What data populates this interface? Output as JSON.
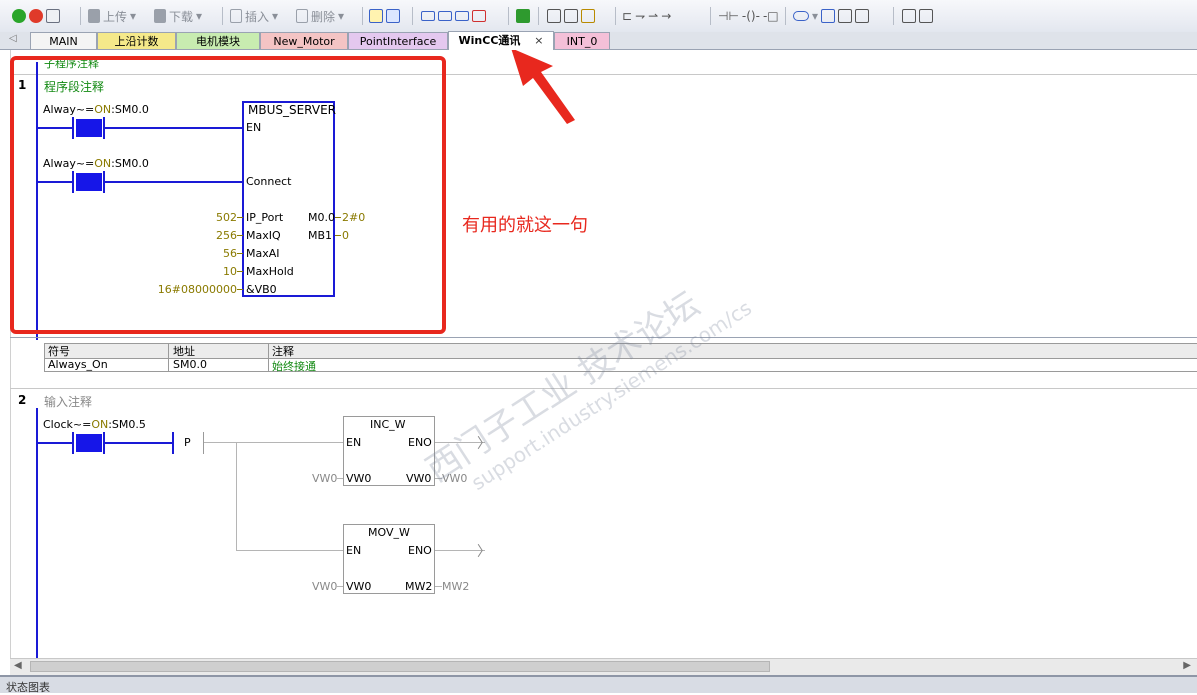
{
  "toolbar": {
    "upload": "上传",
    "download": "下载",
    "insert": "插入",
    "delete": "删除"
  },
  "tabs": [
    {
      "label": "MAIN",
      "color": "#f4f4f4"
    },
    {
      "label": "上沿计数",
      "color": "#f5e98a"
    },
    {
      "label": "电机模块",
      "color": "#c8ecb0"
    },
    {
      "label": "New_Motor",
      "color": "#f4c4c4"
    },
    {
      "label": "PointInterface",
      "color": "#e4c8ef"
    },
    {
      "label": "WinCC通讯",
      "color": "#ffffff"
    },
    {
      "label": "INT_0",
      "color": "#f4c0d8"
    }
  ],
  "tab_close": "×",
  "subroutine_comment": "子程序注释",
  "network1": {
    "number": "1",
    "comment": "程序段注释",
    "contact1": {
      "name": "Alway~",
      "eq": "=",
      "state": "ON",
      "addr": ":SM0.0"
    },
    "contact2": {
      "name": "Alway~",
      "eq": "=",
      "state": "ON",
      "addr": ":SM0.0"
    },
    "block": {
      "title": "MBUS_SERVER",
      "en": "EN",
      "connect": "Connect",
      "inputs": [
        {
          "value": "502",
          "pin": "IP_Port"
        },
        {
          "value": "256",
          "pin": "MaxIQ"
        },
        {
          "value": "56",
          "pin": "MaxAI"
        },
        {
          "value": "10",
          "pin": "MaxHold"
        },
        {
          "value": "16#08000000",
          "pin": "&VB0"
        }
      ],
      "outputs": [
        {
          "pin": "M0.0",
          "value": "2#0"
        },
        {
          "pin": "MB1",
          "value": "0"
        }
      ]
    }
  },
  "annotation": "有用的就这一句",
  "symbol_table": {
    "headers": [
      "符号",
      "地址",
      "注释"
    ],
    "rows": [
      [
        "Always_On",
        "SM0.0",
        "始终接通"
      ]
    ]
  },
  "network2": {
    "number": "2",
    "comment": "输入注释",
    "contact": {
      "name": "Clock~",
      "eq": "=",
      "state": "ON",
      "addr": ":SM0.5"
    },
    "p_label": "P",
    "inc": {
      "title": "INC_W",
      "en": "EN",
      "eno": "ENO",
      "in_pin": "VW0",
      "out_pin": "VW0",
      "in_val": "VW0",
      "out_val": "VW0"
    },
    "mov": {
      "title": "MOV_W",
      "en": "EN",
      "eno": "ENO",
      "in_pin": "VW0",
      "out_pin": "MW2",
      "in_val": "VW0",
      "out_val": "MW2"
    }
  },
  "watermark": {
    "line1": "西门子工业 技术论坛",
    "line2": "support.industry.siemens.com/cs"
  },
  "status_bar": "状态图表",
  "colors": {
    "rail": "#1a1ad6",
    "contact": "#1616e8",
    "highlight": "#e8281e",
    "comment": "#138a13",
    "constant": "#8a7a00"
  }
}
